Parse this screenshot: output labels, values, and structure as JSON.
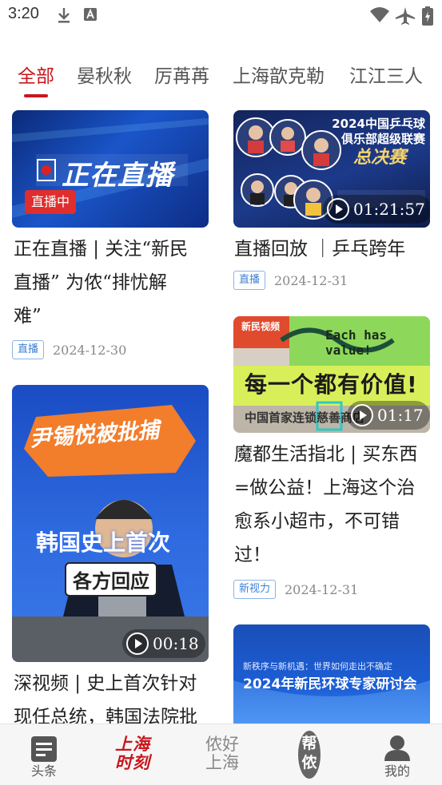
{
  "status_bar": {
    "time": "3:20"
  },
  "tabs": [
    {
      "label": "全部",
      "active": true
    },
    {
      "label": "晏秋秋",
      "active": false
    },
    {
      "label": "厉苒苒",
      "active": false
    },
    {
      "label": "上海歆克勒",
      "active": false
    },
    {
      "label": "江江三人",
      "active": false
    }
  ],
  "cards": {
    "live": {
      "banner_text": "正在直播",
      "badge": "直播中",
      "title_lines": [
        "正在直播 | 关注“新民",
        "直播” 为侬“排忧解",
        "难”"
      ],
      "tag": "直播",
      "date": "2024-12-30"
    },
    "pingpong": {
      "banner_line1": "2024中国乒乓球",
      "banner_line2": "俱乐部超级联赛",
      "banner_line3": "总决赛",
      "duration": "01:21:57",
      "title_lines": [
        "直播回放 ｜乒乓跨年"
      ],
      "tag": "直播",
      "date": "2024-12-31"
    },
    "supermarket": {
      "logo": "新民视频",
      "sign_en": "Each has value!",
      "sign_cn": "每一个都有价值!",
      "sign_sub": "中国首家连锁慈善商店",
      "duration": "01:17",
      "title_lines": [
        "魔都生活指北 | 买东西",
        "=做公益！上海这个治",
        "愈系小超市，不可错",
        "过！"
      ],
      "tag": "新视力",
      "date": "2024-12-31"
    },
    "korea": {
      "headline1": "尹锡悦被批捕",
      "headline2": "韩国史上首次",
      "headline3": "各方回应",
      "duration": "00:18",
      "title_lines": [
        "深视频 | 史上首次针对",
        "现任总统，韩国法院批"
      ]
    },
    "seminar": {
      "line1": "新秩序与新机遇：世界如何走出不确定",
      "line2": "2024年新民环球专家研讨会"
    }
  },
  "bottom_nav": [
    {
      "label": "头条"
    },
    {
      "label": "上海时刻"
    },
    {
      "label": "侬好上海"
    },
    {
      "label": "帮侬"
    },
    {
      "label": "我的"
    }
  ],
  "colors": {
    "accent": "#c8161d",
    "tag_blue": "#3d7fd0"
  }
}
